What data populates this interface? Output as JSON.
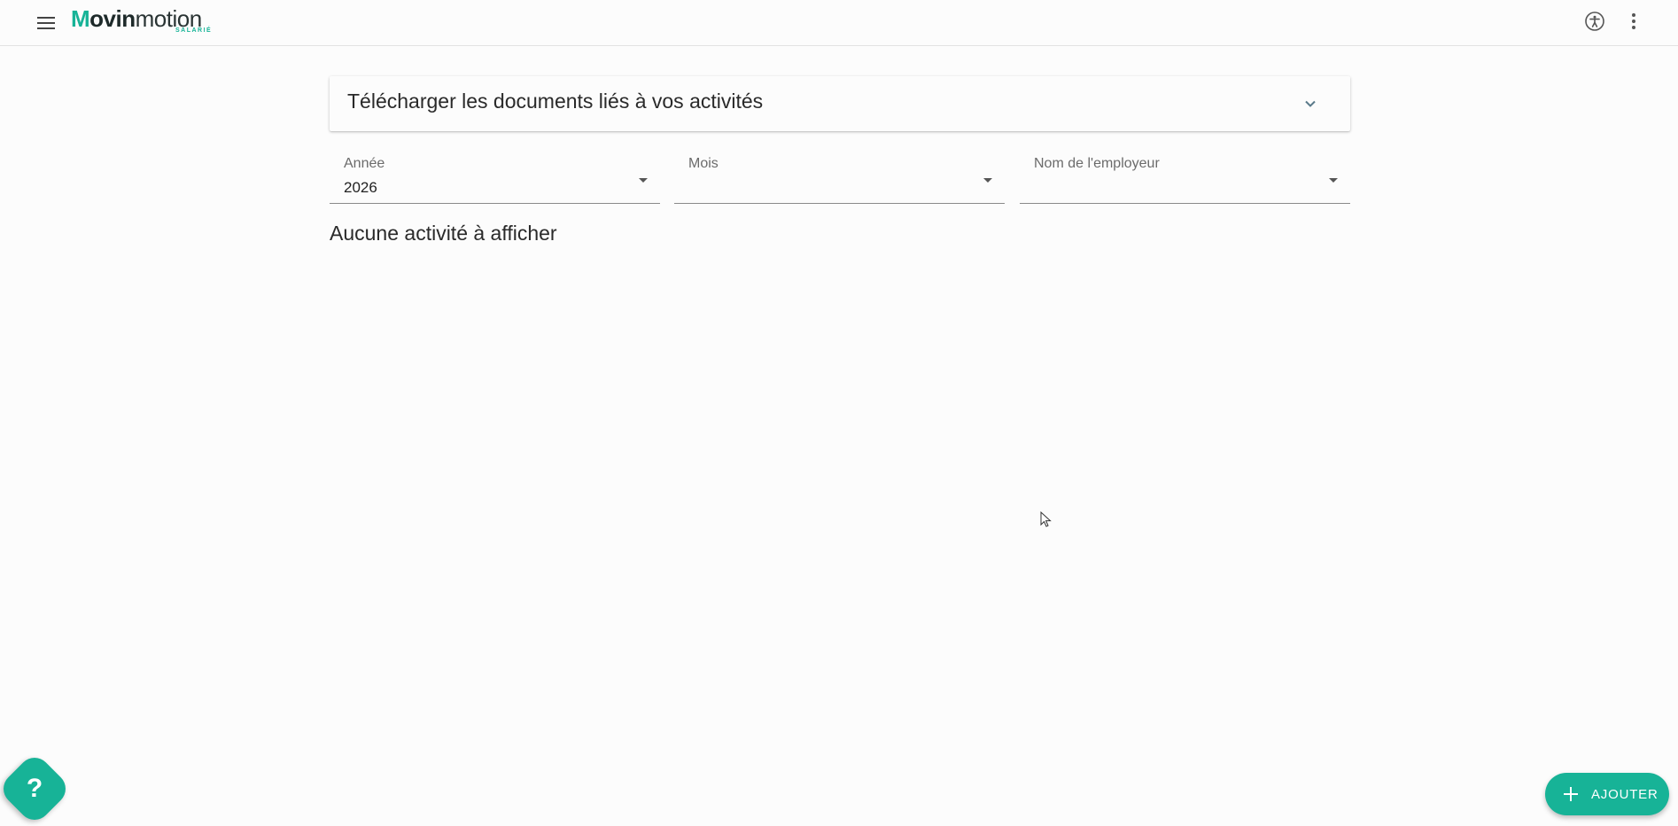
{
  "app": {
    "logo_text_mark": "M",
    "logo_text_bold": "ovin",
    "logo_text_light": "motion",
    "logo_sub": "SALARIÉ"
  },
  "header": {
    "menu_icon": "hamburger-menu-icon",
    "accessibility_icon": "accessibility-icon",
    "more_icon": "more-vertical-icon"
  },
  "download_panel": {
    "title": "Télécharger les documents liés à vos activités",
    "icon": "chevron-down-icon"
  },
  "filters": {
    "year": {
      "label": "Année",
      "value": "2026"
    },
    "month": {
      "label": "Mois",
      "value": ""
    },
    "employer": {
      "label": "Nom de l'employeur",
      "value": ""
    }
  },
  "main": {
    "empty_message": "Aucune activité à afficher"
  },
  "help_button": {
    "label": "?"
  },
  "add_button": {
    "label": "AJOUTER",
    "icon": "plus-icon"
  },
  "colors": {
    "accent": "#17b397"
  }
}
